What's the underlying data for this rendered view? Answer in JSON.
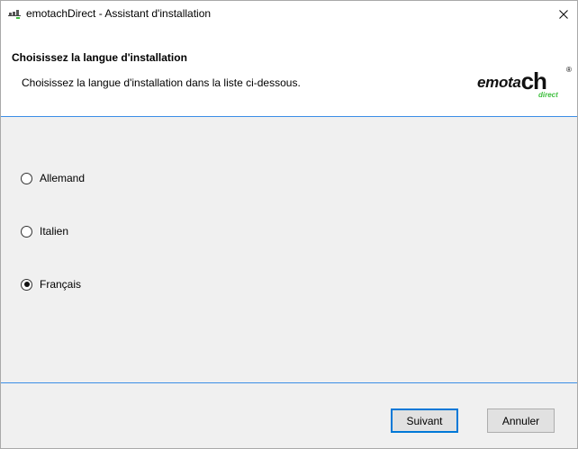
{
  "window": {
    "title": "emotachDirect - Assistant d'installation",
    "app_icon_text": "emotach"
  },
  "header": {
    "title": "Choisissez la langue d'installation",
    "subtitle": "Choisissez la langue d'installation dans la liste ci-dessous."
  },
  "logo": {
    "main_italic": "emota",
    "main_bold": "ch",
    "registered": "®",
    "tagline": "direct"
  },
  "languages": {
    "options": [
      {
        "label": "Allemand",
        "selected": false
      },
      {
        "label": "Italien",
        "selected": false
      },
      {
        "label": "Français",
        "selected": true
      }
    ]
  },
  "footer": {
    "next_label": "Suivant",
    "cancel_label": "Annuler"
  },
  "colors": {
    "accent": "#3c8ee6",
    "default_button_border": "#0078d7",
    "logo_green": "#3fbf3f",
    "background": "#f0f0f0"
  }
}
